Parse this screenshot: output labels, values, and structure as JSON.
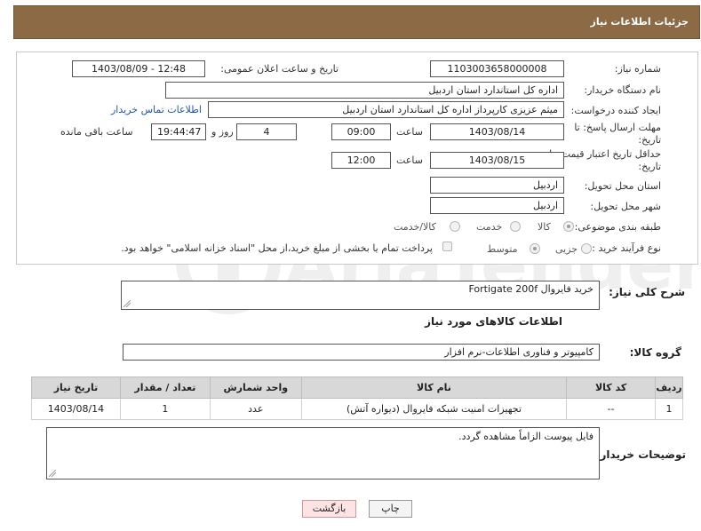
{
  "header": {
    "title": "جزئیات اطلاعات نیاز"
  },
  "fields": {
    "need_number_label": "شماره نیاز:",
    "need_number": "1103003658000008",
    "announce_label": "تاریخ و ساعت اعلان عمومی:",
    "announce_value": "1403/08/09 - 12:48",
    "buyer_org_label": "نام دستگاه خریدار:",
    "buyer_org": "اداره کل استاندارد استان اردبیل",
    "creator_label": "ایجاد کننده درخواست:",
    "creator": "میثم عزیزی کارپرداز اداره کل استاندارد استان اردبیل",
    "contact_link": "اطلاعات تماس خریدار",
    "deadline_label_1": "مهلت ارسال پاسخ: تا",
    "deadline_label_2": "تاریخ:",
    "deadline_date": "1403/08/14",
    "hour_label": "ساعت",
    "deadline_time": "09:00",
    "days_value": "4",
    "days_label": "روز و",
    "remaining_time": "19:44:47",
    "remaining_label": "ساعت باقی مانده",
    "validity_label_1": "حداقل تاریخ اعتبار قیمت: تا",
    "validity_label_2": "تاریخ:",
    "validity_date": "1403/08/15",
    "validity_time": "12:00",
    "province_label": "استان محل تحویل:",
    "province": "اردبیل",
    "city_label": "شهر محل تحویل:",
    "city": "اردبیل",
    "category_label": "طبقه بندی موضوعی:",
    "category_options": [
      "کالا",
      "خدمت",
      "کالا/خدمت"
    ],
    "category_selected": "کالا",
    "purchase_label": "نوع فرآیند خرید :",
    "purchase_options": [
      "جزیی",
      "متوسط"
    ],
    "purchase_selected": "متوسط",
    "payment_note": "پرداخت تمام یا بخشی از مبلغ خرید،از محل \"اسناد خزانه اسلامی\" خواهد بود."
  },
  "summary": {
    "label": "شرح کلی نیاز:",
    "value": "خرید فایروال Fortigate 200f"
  },
  "goods_info_title": "اطلاعات کالاهای مورد نیاز",
  "goods_group": {
    "label": "گروه کالا:",
    "value": "کامپیوتر و فناوری اطلاعات-نرم افزار"
  },
  "table": {
    "headers": [
      "ردیف",
      "کد کالا",
      "نام کالا",
      "واحد شمارش",
      "تعداد / مقدار",
      "تاریخ نیاز"
    ],
    "rows": [
      [
        "1",
        "--",
        "تجهیزات امنیت شبکه فایروال (دیواره آتش)",
        "عدد",
        "1",
        "1403/08/14"
      ]
    ]
  },
  "buyer_notes": {
    "label": "توضیحات خریدار:",
    "value": "فایل پیوست الزاماً مشاهده گردد."
  },
  "buttons": {
    "print": "چاپ",
    "back": "بازگشت"
  },
  "watermark": "AriaTender.neT"
}
